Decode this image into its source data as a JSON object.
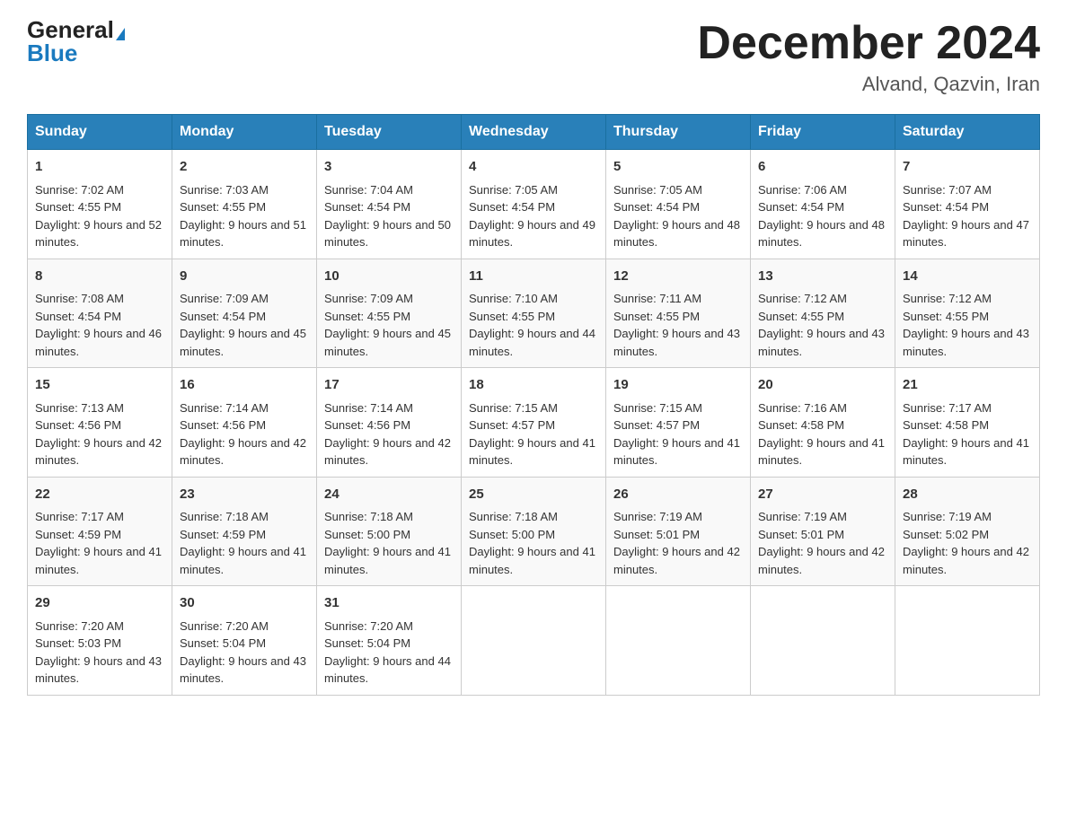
{
  "header": {
    "logo_general": "General",
    "logo_blue": "Blue",
    "month_title": "December 2024",
    "location": "Alvand, Qazvin, Iran"
  },
  "days_of_week": [
    "Sunday",
    "Monday",
    "Tuesday",
    "Wednesday",
    "Thursday",
    "Friday",
    "Saturday"
  ],
  "weeks": [
    [
      {
        "day": 1,
        "sunrise": "7:02 AM",
        "sunset": "4:55 PM",
        "daylight": "9 hours and 52 minutes."
      },
      {
        "day": 2,
        "sunrise": "7:03 AM",
        "sunset": "4:55 PM",
        "daylight": "9 hours and 51 minutes."
      },
      {
        "day": 3,
        "sunrise": "7:04 AM",
        "sunset": "4:54 PM",
        "daylight": "9 hours and 50 minutes."
      },
      {
        "day": 4,
        "sunrise": "7:05 AM",
        "sunset": "4:54 PM",
        "daylight": "9 hours and 49 minutes."
      },
      {
        "day": 5,
        "sunrise": "7:05 AM",
        "sunset": "4:54 PM",
        "daylight": "9 hours and 48 minutes."
      },
      {
        "day": 6,
        "sunrise": "7:06 AM",
        "sunset": "4:54 PM",
        "daylight": "9 hours and 48 minutes."
      },
      {
        "day": 7,
        "sunrise": "7:07 AM",
        "sunset": "4:54 PM",
        "daylight": "9 hours and 47 minutes."
      }
    ],
    [
      {
        "day": 8,
        "sunrise": "7:08 AM",
        "sunset": "4:54 PM",
        "daylight": "9 hours and 46 minutes."
      },
      {
        "day": 9,
        "sunrise": "7:09 AM",
        "sunset": "4:54 PM",
        "daylight": "9 hours and 45 minutes."
      },
      {
        "day": 10,
        "sunrise": "7:09 AM",
        "sunset": "4:55 PM",
        "daylight": "9 hours and 45 minutes."
      },
      {
        "day": 11,
        "sunrise": "7:10 AM",
        "sunset": "4:55 PM",
        "daylight": "9 hours and 44 minutes."
      },
      {
        "day": 12,
        "sunrise": "7:11 AM",
        "sunset": "4:55 PM",
        "daylight": "9 hours and 43 minutes."
      },
      {
        "day": 13,
        "sunrise": "7:12 AM",
        "sunset": "4:55 PM",
        "daylight": "9 hours and 43 minutes."
      },
      {
        "day": 14,
        "sunrise": "7:12 AM",
        "sunset": "4:55 PM",
        "daylight": "9 hours and 43 minutes."
      }
    ],
    [
      {
        "day": 15,
        "sunrise": "7:13 AM",
        "sunset": "4:56 PM",
        "daylight": "9 hours and 42 minutes."
      },
      {
        "day": 16,
        "sunrise": "7:14 AM",
        "sunset": "4:56 PM",
        "daylight": "9 hours and 42 minutes."
      },
      {
        "day": 17,
        "sunrise": "7:14 AM",
        "sunset": "4:56 PM",
        "daylight": "9 hours and 42 minutes."
      },
      {
        "day": 18,
        "sunrise": "7:15 AM",
        "sunset": "4:57 PM",
        "daylight": "9 hours and 41 minutes."
      },
      {
        "day": 19,
        "sunrise": "7:15 AM",
        "sunset": "4:57 PM",
        "daylight": "9 hours and 41 minutes."
      },
      {
        "day": 20,
        "sunrise": "7:16 AM",
        "sunset": "4:58 PM",
        "daylight": "9 hours and 41 minutes."
      },
      {
        "day": 21,
        "sunrise": "7:17 AM",
        "sunset": "4:58 PM",
        "daylight": "9 hours and 41 minutes."
      }
    ],
    [
      {
        "day": 22,
        "sunrise": "7:17 AM",
        "sunset": "4:59 PM",
        "daylight": "9 hours and 41 minutes."
      },
      {
        "day": 23,
        "sunrise": "7:18 AM",
        "sunset": "4:59 PM",
        "daylight": "9 hours and 41 minutes."
      },
      {
        "day": 24,
        "sunrise": "7:18 AM",
        "sunset": "5:00 PM",
        "daylight": "9 hours and 41 minutes."
      },
      {
        "day": 25,
        "sunrise": "7:18 AM",
        "sunset": "5:00 PM",
        "daylight": "9 hours and 41 minutes."
      },
      {
        "day": 26,
        "sunrise": "7:19 AM",
        "sunset": "5:01 PM",
        "daylight": "9 hours and 42 minutes."
      },
      {
        "day": 27,
        "sunrise": "7:19 AM",
        "sunset": "5:01 PM",
        "daylight": "9 hours and 42 minutes."
      },
      {
        "day": 28,
        "sunrise": "7:19 AM",
        "sunset": "5:02 PM",
        "daylight": "9 hours and 42 minutes."
      }
    ],
    [
      {
        "day": 29,
        "sunrise": "7:20 AM",
        "sunset": "5:03 PM",
        "daylight": "9 hours and 43 minutes."
      },
      {
        "day": 30,
        "sunrise": "7:20 AM",
        "sunset": "5:04 PM",
        "daylight": "9 hours and 43 minutes."
      },
      {
        "day": 31,
        "sunrise": "7:20 AM",
        "sunset": "5:04 PM",
        "daylight": "9 hours and 44 minutes."
      },
      null,
      null,
      null,
      null
    ]
  ]
}
